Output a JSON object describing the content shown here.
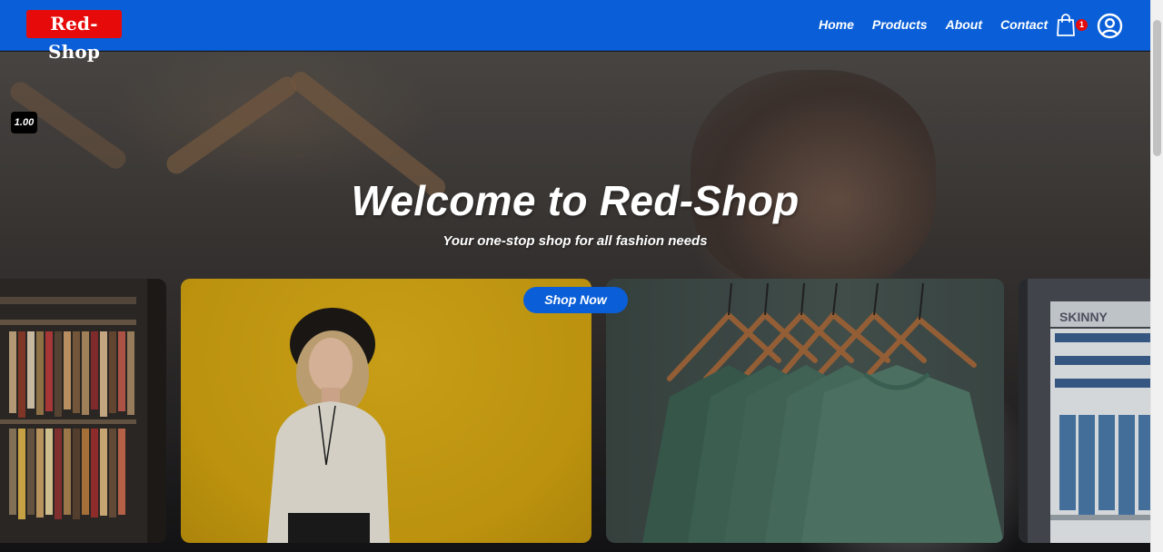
{
  "header": {
    "logo": "Red-Shop",
    "nav": [
      "Home",
      "Products",
      "About",
      "Contact"
    ],
    "cart_count": "1",
    "cart_icon": "shopping-bag-icon",
    "user_icon": "user-circle-icon"
  },
  "hero": {
    "speed_badge": "1.00",
    "title": "Welcome to Red-Shop",
    "subtitle": "Your one-stop shop for all fashion needs",
    "cta": "Shop Now",
    "carousel": [
      {
        "name": "clothing-racks-store"
      },
      {
        "name": "woman-in-hat-yellow-wall"
      },
      {
        "name": "green-tshirts-on-hangers"
      },
      {
        "name": "skinny-jeans-shelf"
      }
    ]
  },
  "colors": {
    "primary": "#0a5fd8",
    "brand_red": "#e60a0a",
    "text_light": "#ffffff"
  }
}
